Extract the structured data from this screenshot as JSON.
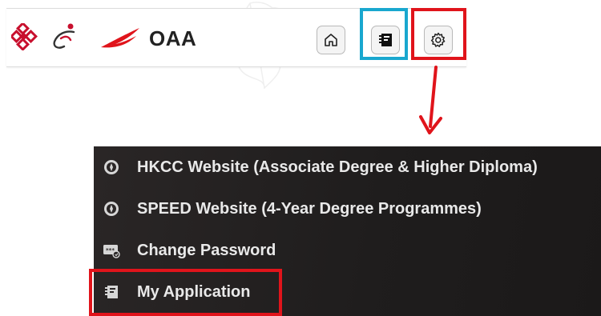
{
  "header": {
    "app_title": "OAA",
    "buttons": [
      {
        "icon": "home-icon"
      },
      {
        "icon": "my-application-icon"
      },
      {
        "icon": "gear-icon"
      }
    ]
  },
  "menu": {
    "items": [
      {
        "label": "HKCC Website (Associate Degree & Higher Diploma)",
        "icon": "compass-icon"
      },
      {
        "label": "SPEED Website (4-Year Degree Programmes)",
        "icon": "compass-icon"
      },
      {
        "label": "Change Password",
        "icon": "password-icon"
      },
      {
        "label": "My Application",
        "icon": "my-application-icon"
      }
    ]
  },
  "colors": {
    "highlight_blue": "#19a7cf",
    "highlight_red": "#e0141b",
    "logo_red": "#c8102e",
    "menu_bg": "#222020",
    "menu_text": "#e9e9e9"
  }
}
